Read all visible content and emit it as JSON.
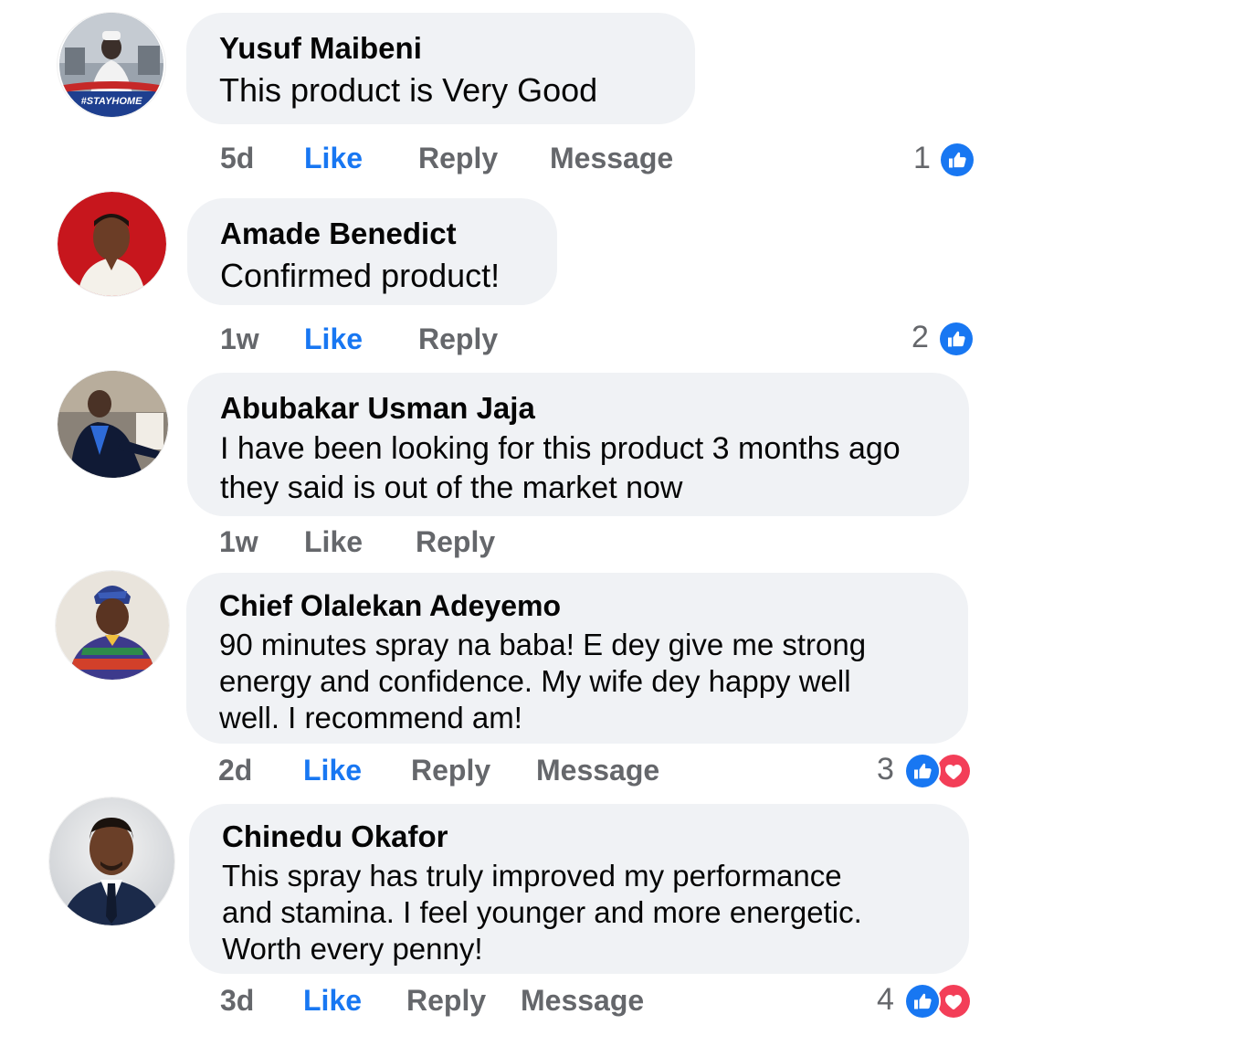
{
  "colors": {
    "bubble_bg": "#f0f2f5",
    "action_gray": "#65676b",
    "like_blue": "#1877f2",
    "love_red": "#f33e58"
  },
  "comments": [
    {
      "author": "Yusuf Maibeni",
      "text": "This product is Very Good",
      "time": "5d",
      "like_label": "Like",
      "reply_label": "Reply",
      "message_label": "Message",
      "reaction_count": "1",
      "reactions": [
        "like-icon"
      ],
      "avatar_caption": "#STAYHOME",
      "like_active": true
    },
    {
      "author": "Amade Benedict",
      "text": "Confirmed product!",
      "time": "1w",
      "like_label": "Like",
      "reply_label": "Reply",
      "reaction_count": "2",
      "reactions": [
        "like-icon"
      ],
      "like_active": true
    },
    {
      "author": "Abubakar Usman Jaja",
      "text": "I have been looking for this product 3 months ago they said is out of the market now",
      "time": "1w",
      "like_label": "Like",
      "reply_label": "Reply",
      "like_active": false
    },
    {
      "author": "Chief Olalekan Adeyemo",
      "text": "90 minutes spray na baba! E dey give me strong energy and confidence. My wife dey happy well well. I recommend am!",
      "time": "2d",
      "like_label": "Like",
      "reply_label": "Reply",
      "message_label": "Message",
      "reaction_count": "3",
      "reactions": [
        "like-icon",
        "love-icon"
      ],
      "like_active": true
    },
    {
      "author": "Chinedu Okafor",
      "text": "This spray has truly improved my performance and stamina. I feel younger and more energetic. Worth every penny!",
      "time": "3d",
      "like_label": "Like",
      "reply_label": "Reply",
      "message_label": "Message",
      "reaction_count": "4",
      "reactions": [
        "like-icon",
        "love-icon"
      ],
      "like_active": true
    }
  ]
}
